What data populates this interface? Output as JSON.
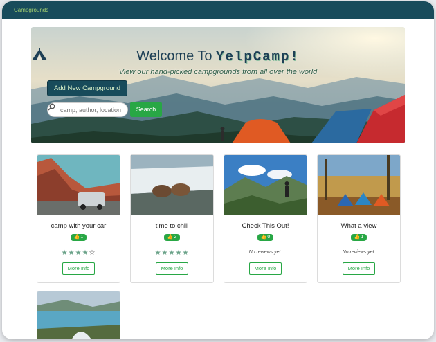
{
  "navbar": {
    "brand": "Campgrounds"
  },
  "hero": {
    "welcome_prefix": "Welcome To",
    "brand_name": "YelpCamp!",
    "subtitle": "View our hand-picked campgrounds from all over the world",
    "add_button": "Add New Campground",
    "search": {
      "placeholder": "camp, author, location",
      "button": "Search"
    }
  },
  "cards": [
    {
      "title": "camp with your car",
      "likes": "1",
      "rating": 4,
      "reviews_text": "",
      "button": "More Info"
    },
    {
      "title": "time to chill",
      "likes": "2",
      "rating": 5,
      "reviews_text": "",
      "button": "More Info"
    },
    {
      "title": "Check This Out!",
      "likes": "0",
      "rating": 0,
      "reviews_text": "No reviews yet.",
      "button": "More Info"
    },
    {
      "title": "What a view",
      "likes": "1",
      "rating": 0,
      "reviews_text": "No reviews yet.",
      "button": "More Info"
    }
  ],
  "colors": {
    "navbar": "#184b5b",
    "accent": "#28a745",
    "brand": "#a4d070"
  }
}
